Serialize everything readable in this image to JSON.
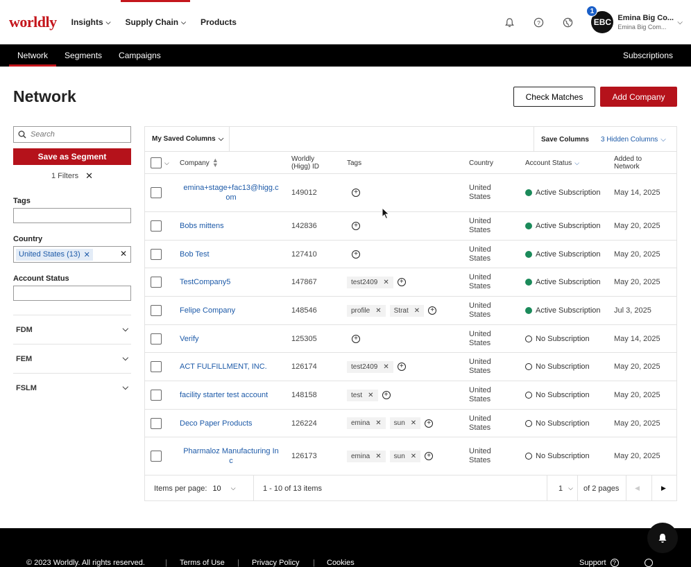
{
  "brand": {
    "logo": "worldly",
    "accent": "#c4161c"
  },
  "nav": {
    "insights": "Insights",
    "supply_chain": "Supply Chain",
    "products": "Products"
  },
  "user": {
    "initials": "EBC",
    "badge": "1",
    "name": "Emina Big Co...",
    "sub": "Emina Big Com..."
  },
  "subnav": {
    "network": "Network",
    "segments": "Segments",
    "campaigns": "Campaigns",
    "subscriptions": "Subscriptions"
  },
  "page": {
    "title": "Network",
    "check_matches": "Check Matches",
    "add_company": "Add Company"
  },
  "sidebar": {
    "search_placeholder": "Search",
    "save_segment": "Save as Segment",
    "filters": "1 Filters",
    "tags_label": "Tags",
    "country_label": "Country",
    "country_chip": "United States (13)",
    "account_status_label": "Account Status",
    "accordions": [
      "FDM",
      "FEM",
      "FSLM"
    ]
  },
  "table": {
    "saved_columns": "My Saved Columns",
    "save_columns": "Save Columns",
    "hidden_columns": "3 Hidden Columns",
    "headers": {
      "company": "Company",
      "worldly_id_1": "Worldly",
      "worldly_id_2": "(Higg) ID",
      "tags": "Tags",
      "country": "Country",
      "status": "Account Status",
      "added_1": "Added to",
      "added_2": "Network"
    },
    "rows": [
      {
        "company": "emina+stage+fac13@higg.com",
        "company_l1": "emina+stage+fac13@higg.c",
        "company_l2": "om",
        "id": "149012",
        "tags": [],
        "country_1": "United",
        "country_2": "States",
        "status": "Active Subscription",
        "active": true,
        "date": "May 14, 2025"
      },
      {
        "company": "Bobs mittens",
        "id": "142836",
        "tags": [],
        "country_1": "United",
        "country_2": "States",
        "status": "Active Subscription",
        "active": true,
        "date": "May 20, 2025"
      },
      {
        "company": "Bob Test",
        "id": "127410",
        "tags": [],
        "country_1": "United",
        "country_2": "States",
        "status": "Active Subscription",
        "active": true,
        "date": "May 20, 2025"
      },
      {
        "company": "TestCompany5",
        "id": "147867",
        "tags": [
          "test2409"
        ],
        "country_1": "United",
        "country_2": "States",
        "status": "Active Subscription",
        "active": true,
        "date": "May 20, 2025"
      },
      {
        "company": "Felipe Company",
        "id": "148546",
        "tags": [
          "profile",
          "Strat"
        ],
        "country_1": "United",
        "country_2": "States",
        "status": "Active Subscription",
        "active": true,
        "date": "Jul 3, 2025"
      },
      {
        "company": "Verify",
        "id": "125305",
        "tags": [],
        "country_1": "United",
        "country_2": "States",
        "status": "No Subscription",
        "active": false,
        "date": "May 14, 2025"
      },
      {
        "company": "ACT FULFILLMENT, INC.",
        "id": "126174",
        "tags": [
          "test2409"
        ],
        "country_1": "United",
        "country_2": "States",
        "status": "No Subscription",
        "active": false,
        "date": "May 20, 2025"
      },
      {
        "company": "facility starter test account",
        "id": "148158",
        "tags": [
          "test"
        ],
        "country_1": "United",
        "country_2": "States",
        "status": "No Subscription",
        "active": false,
        "date": "May 20, 2025"
      },
      {
        "company": "Deco Paper Products",
        "id": "126224",
        "tags": [
          "emina",
          "sun"
        ],
        "country_1": "United",
        "country_2": "States",
        "status": "No Subscription",
        "active": false,
        "date": "May 20, 2025"
      },
      {
        "company": "Pharmaloz Manufacturing Inc",
        "company_l1": "Pharmaloz Manufacturing In",
        "company_l2": "c",
        "id": "126173",
        "tags": [
          "emina",
          "sun"
        ],
        "country_1": "United",
        "country_2": "States",
        "status": "No Subscription",
        "active": false,
        "date": "May 20, 2025"
      }
    ]
  },
  "pager": {
    "items_per_page_label": "Items per page:",
    "items_per_page": "10",
    "range": "1 - 10 of 13 items",
    "page": "1",
    "of_pages": "of 2 pages"
  },
  "footer": {
    "copyright": "© 2023 Worldly. All rights reserved.",
    "terms": "Terms of Use",
    "privacy": "Privacy Policy",
    "cookies": "Cookies",
    "support": "Support"
  }
}
